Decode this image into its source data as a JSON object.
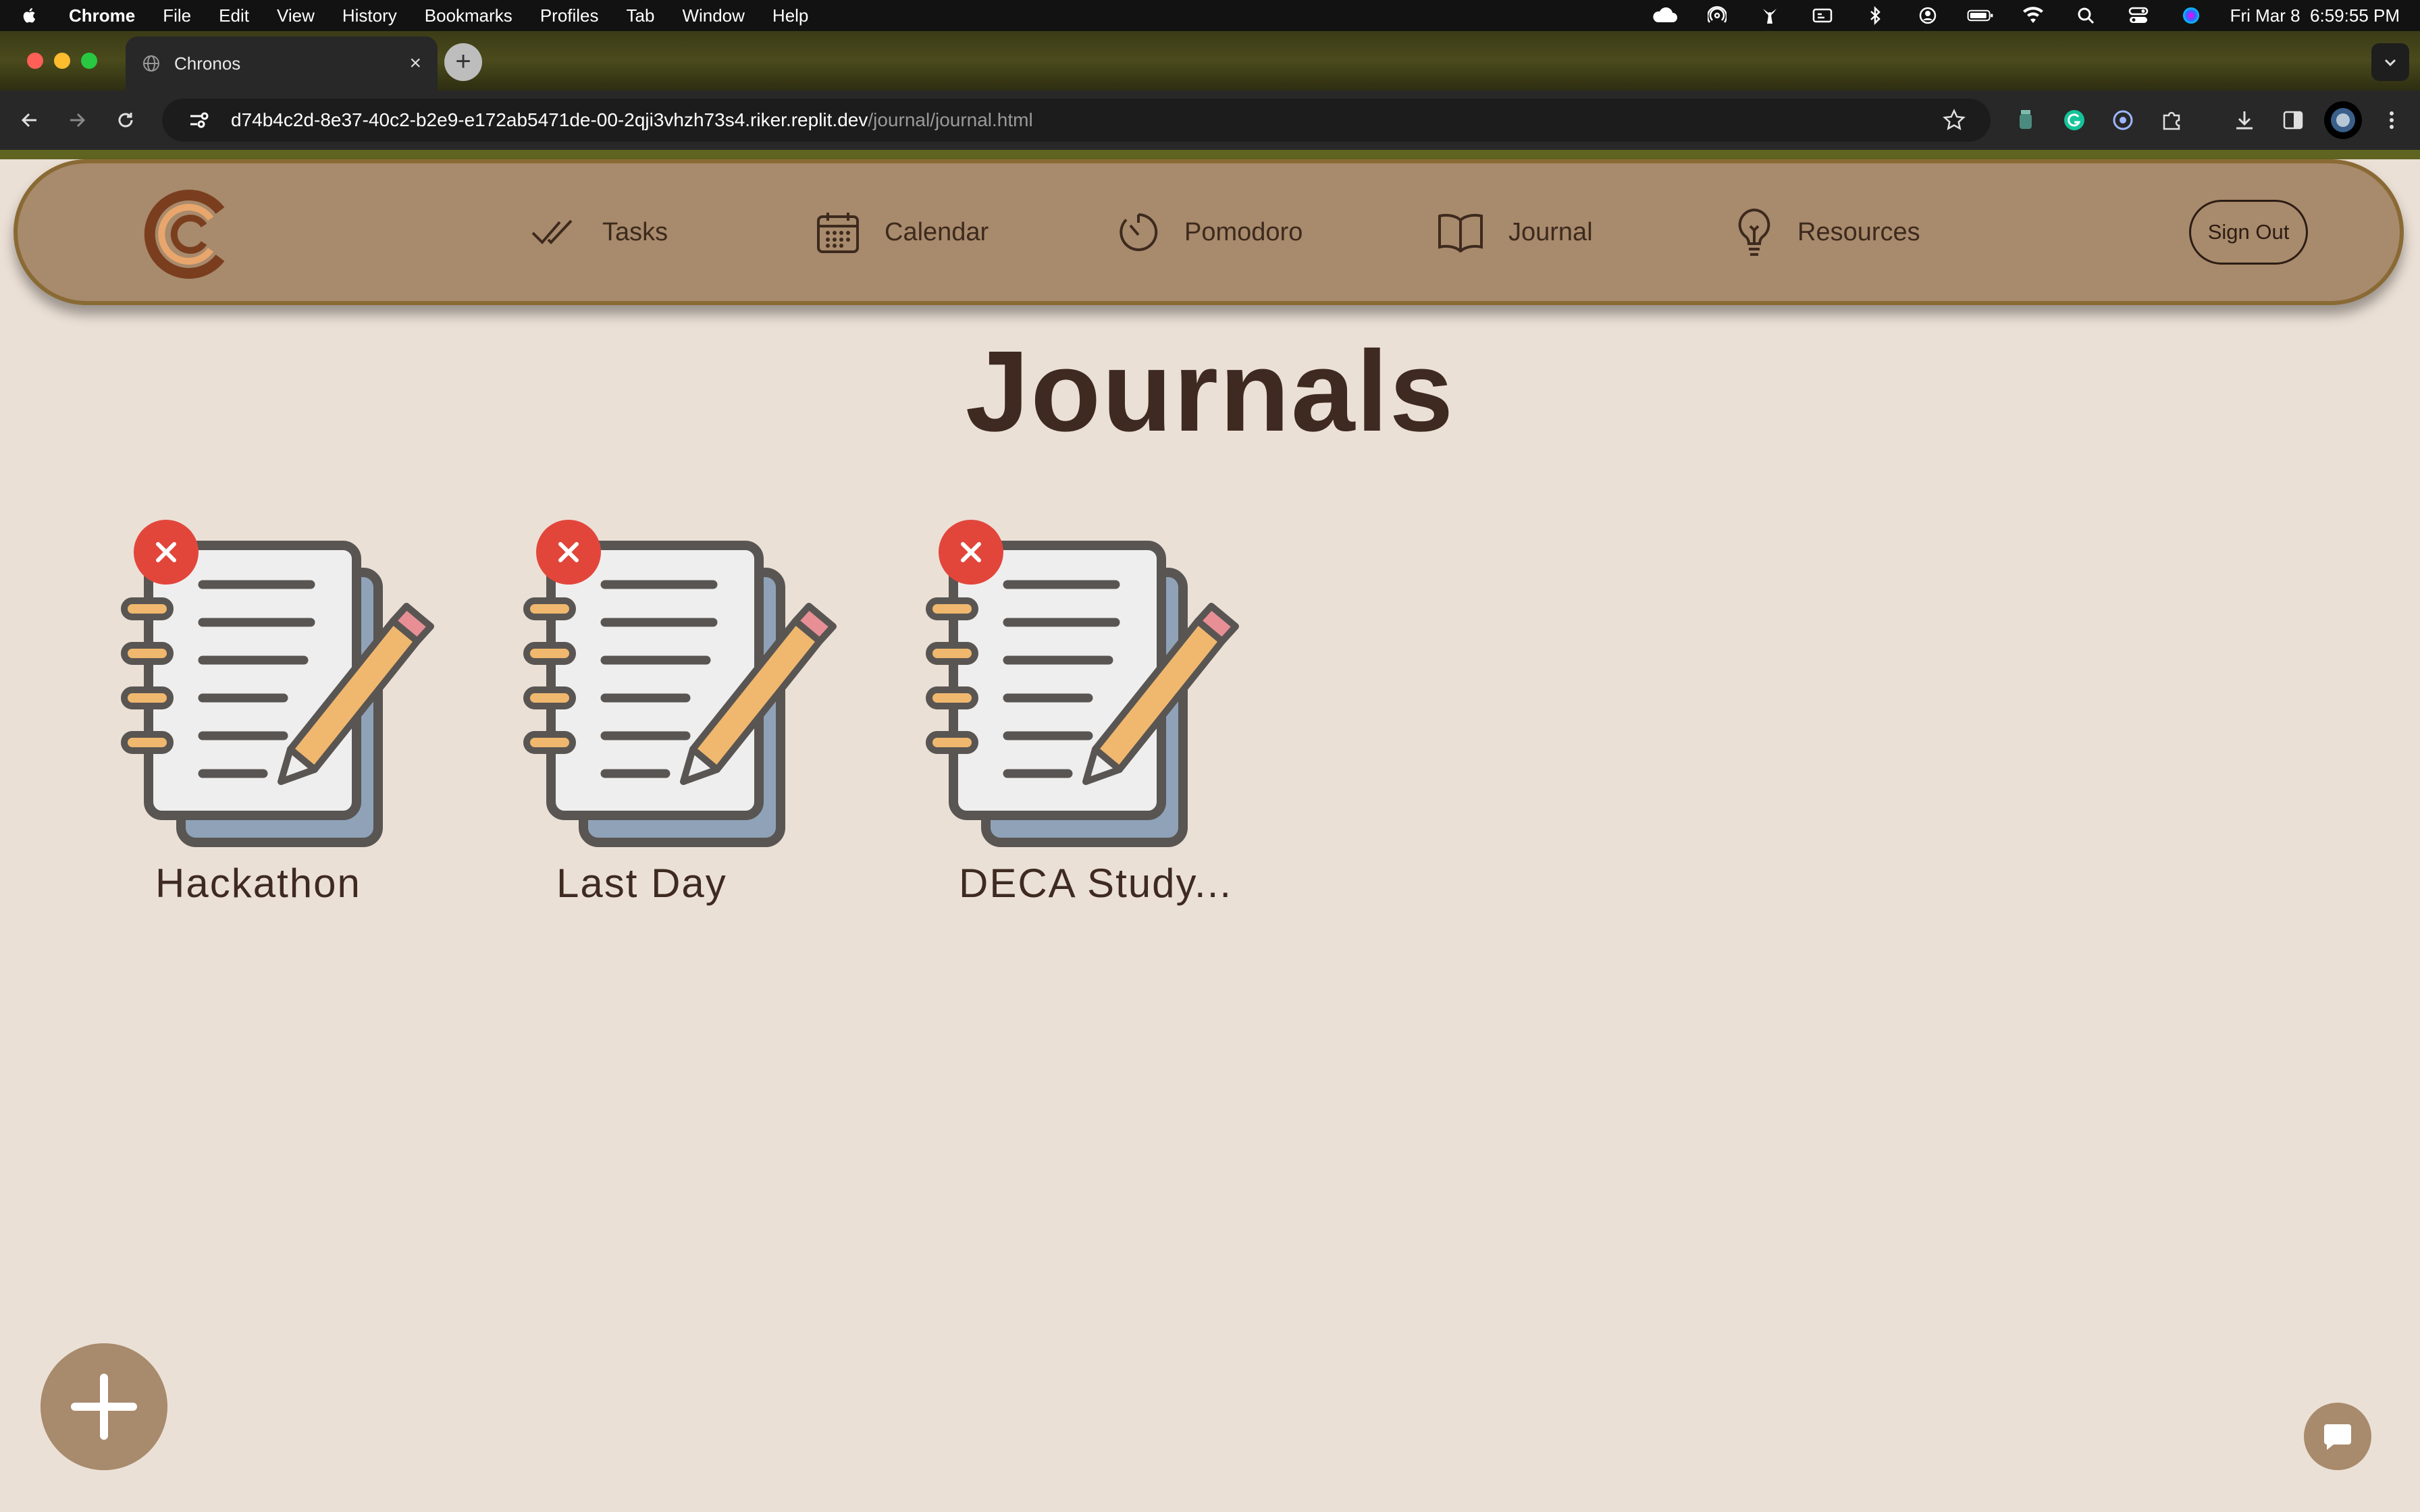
{
  "menubar": {
    "app": "Chrome",
    "items": [
      "File",
      "Edit",
      "View",
      "History",
      "Bookmarks",
      "Profiles",
      "Tab",
      "Window",
      "Help"
    ],
    "clock": "Fri Mar 8  6:59:55 PM",
    "icons": [
      "cloud-icon",
      "airdrop-icon",
      "fan-icon",
      "display-icon",
      "bluetooth-icon",
      "user-icon",
      "battery-icon",
      "wifi-icon",
      "spotlight-icon",
      "control-center-icon",
      "siri-icon"
    ]
  },
  "browser": {
    "tab_title": "Chronos",
    "url_host": "d74b4c2d-8e37-40c2-b2e9-e172ab5471de-00-2qji3vhzh73s4.riker.replit.dev",
    "url_path": "/journal/journal.html"
  },
  "nav": {
    "items": [
      {
        "label": "Tasks",
        "icon": "double-check-icon"
      },
      {
        "label": "Calendar",
        "icon": "calendar-icon"
      },
      {
        "label": "Pomodoro",
        "icon": "timer-icon"
      },
      {
        "label": "Journal",
        "icon": "open-book-icon"
      },
      {
        "label": "Resources",
        "icon": "lightbulb-icon"
      }
    ],
    "sign_out": "Sign Out"
  },
  "page": {
    "title": "Journals"
  },
  "journals": [
    {
      "title": "Hackathon"
    },
    {
      "title": "Last Day"
    },
    {
      "title": "DECA Study..."
    }
  ],
  "colors": {
    "page_bg": "#ebe0d6",
    "nav_bg": "#a88a6c",
    "nav_border": "#8a6a34",
    "title_text": "#3e2a20",
    "delete_red": "#e2463b",
    "pencil": "#f0b86e",
    "notebook_back": "#8fa2b8"
  }
}
